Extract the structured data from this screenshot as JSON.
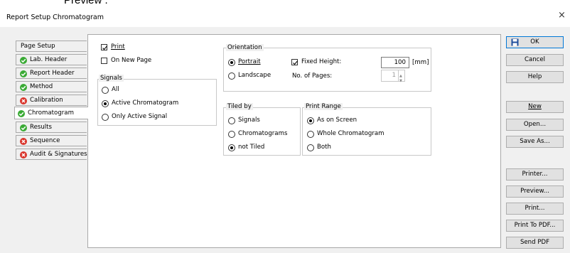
{
  "partial_heading": "Preview .",
  "window": {
    "title": "Report Setup Chromatogram",
    "close_glyph": "×"
  },
  "tabs": [
    {
      "label": "Page Setup",
      "status": "none"
    },
    {
      "label": "Lab. Header",
      "status": "ok"
    },
    {
      "label": "Report Header",
      "status": "ok"
    },
    {
      "label": "Method",
      "status": "ok"
    },
    {
      "label": "Calibration",
      "status": "error"
    },
    {
      "label": "Chromatogram",
      "status": "ok",
      "selected": true
    },
    {
      "label": "Results",
      "status": "ok"
    },
    {
      "label": "Sequence",
      "status": "error"
    },
    {
      "label": "Audit & Signatures",
      "status": "error"
    }
  ],
  "print": {
    "label": "Print",
    "checked": true
  },
  "on_new_page": {
    "label": "On New Page",
    "checked": false
  },
  "signals": {
    "title": "Signals",
    "options": [
      {
        "label": "All",
        "selected": false
      },
      {
        "label": "Active Chromatogram",
        "selected": true
      },
      {
        "label": "Only Active Signal",
        "selected": false
      }
    ]
  },
  "orientation": {
    "title": "Orientation",
    "portrait": "Portrait",
    "landscape": "Landscape",
    "selected": "portrait",
    "fixed_height_label": "Fixed Height:",
    "fixed_height_checked": true,
    "fixed_height_value": "100",
    "fixed_height_unit": "[mm]",
    "pages_label": "No. of Pages:",
    "pages_value": "1"
  },
  "tiled_by": {
    "title": "Tiled by",
    "options": [
      {
        "label": "Signals",
        "selected": false
      },
      {
        "label": "Chromatograms",
        "selected": false
      },
      {
        "label": "not Tiled",
        "selected": true
      }
    ]
  },
  "print_range": {
    "title": "Print Range",
    "options": [
      {
        "label": "As on Screen",
        "selected": true
      },
      {
        "label": "Whole Chromatogram",
        "selected": false
      },
      {
        "label": "Both",
        "selected": false
      }
    ]
  },
  "buttons": {
    "ok": "OK",
    "cancel": "Cancel",
    "help": "Help",
    "new": "New",
    "open": "Open...",
    "save_as": "Save As...",
    "printer": "Printer...",
    "preview": "Preview...",
    "print": "Print...",
    "print_to_pdf": "Print To PDF...",
    "send_pdf": "Send PDF"
  },
  "colors": {
    "ok_icon": "#3aaa35",
    "error_icon": "#d9342b",
    "accent": "#0078d7",
    "save_icon": "#1f4e9c"
  }
}
